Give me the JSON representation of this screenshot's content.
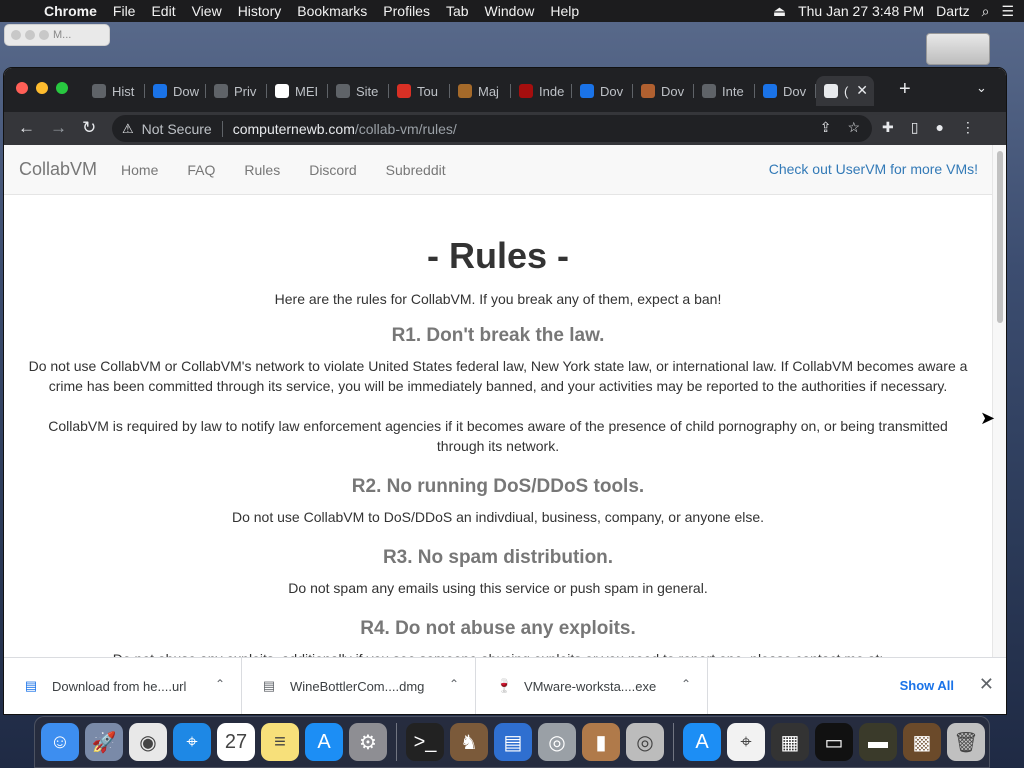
{
  "menubar": {
    "app": "Chrome",
    "items": [
      "File",
      "Edit",
      "View",
      "History",
      "Bookmarks",
      "Profiles",
      "Tab",
      "Window",
      "Help"
    ],
    "clock": "Thu Jan 27  3:48 PM",
    "user": "Dartz"
  },
  "minimized_window": {
    "label": "M..."
  },
  "browser": {
    "tabs": [
      {
        "label": "Hist",
        "icon": "history-icon",
        "color": "#5f6368"
      },
      {
        "label": "Dow",
        "icon": "chart-icon",
        "color": "#1a73e8"
      },
      {
        "label": "Priv",
        "icon": "flask-icon",
        "color": "#5f6368"
      },
      {
        "label": "MEI",
        "icon": "google-icon",
        "color": "#ffffff"
      },
      {
        "label": "Site",
        "icon": "globe-icon",
        "color": "#5f6368"
      },
      {
        "label": "Tou",
        "icon": "store-icon",
        "color": "#d93025"
      },
      {
        "label": "Maj",
        "icon": "lion-icon",
        "color": "#a56a2a"
      },
      {
        "label": "Inde",
        "icon": "wine-icon",
        "color": "#a50e0e"
      },
      {
        "label": "Dov",
        "icon": "vmware-icon",
        "color": "#1a73e8"
      },
      {
        "label": "Dov",
        "icon": "bottle-icon",
        "color": "#b06030"
      },
      {
        "label": "Inte",
        "icon": "archive-icon",
        "color": "#5f6368"
      },
      {
        "label": "Dov",
        "icon": "vmware-icon",
        "color": "#1a73e8"
      }
    ],
    "active_tab": {
      "label": "(",
      "icon": "collabvm-icon"
    },
    "address": {
      "security": "Not Secure",
      "host": "computernewb.com",
      "path": "/collab-vm/rules/"
    }
  },
  "site": {
    "brand": "CollabVM",
    "nav": [
      "Home",
      "FAQ",
      "Rules",
      "Discord",
      "Subreddit"
    ],
    "promo": "Check out UserVM for more VMs!",
    "title": "- Rules -",
    "intro": "Here are the rules for CollabVM. If you break any of them, expect a ban!",
    "rules": [
      {
        "heading": "R1. Don't break the law.",
        "paragraphs": [
          "Do not use CollabVM or CollabVM's network to violate United States federal law, New York state law, or international law. If CollabVM becomes aware a crime has been committed through its service, you will be immediately banned, and your activities may be reported to the authorities if necessary.",
          "CollabVM is required by law to notify law enforcement agencies if it becomes aware of the presence of child pornography on, or being transmitted through its network."
        ]
      },
      {
        "heading": "R2. No running DoS/DDoS tools.",
        "paragraphs": [
          "Do not use CollabVM to DoS/DDoS an indivdiual, business, company, or anyone else."
        ]
      },
      {
        "heading": "R3. No spam distribution.",
        "paragraphs": [
          "Do not spam any emails using this service or push spam in general."
        ]
      },
      {
        "heading": "R4. Do not abuse any exploits.",
        "paragraphs": [
          "Do not abuse any exploits, additionally if you see someone abusing exploits or you need to report one, please contact me at:"
        ]
      }
    ]
  },
  "downloads": {
    "items": [
      {
        "name": "Download from he....url",
        "icon": "url-file-icon"
      },
      {
        "name": "WineBottlerCom....dmg",
        "icon": "dmg-file-icon"
      },
      {
        "name": "VMware-worksta....exe",
        "icon": "wine-file-icon"
      }
    ],
    "show_all": "Show All"
  },
  "dock": {
    "apps": [
      {
        "name": "finder-icon",
        "bg": "#3d8ef0",
        "glyph": "☺"
      },
      {
        "name": "launchpad-icon",
        "bg": "#7a8aa8",
        "glyph": "🚀"
      },
      {
        "name": "chrome-icon",
        "bg": "#e8e8e8",
        "glyph": "◉"
      },
      {
        "name": "safari-icon",
        "bg": "#1e88e5",
        "glyph": "⌖"
      },
      {
        "name": "calendar-icon",
        "bg": "#ffffff",
        "glyph": "27"
      },
      {
        "name": "notes-icon",
        "bg": "#f7e07a",
        "glyph": "≡"
      },
      {
        "name": "app-store-icon",
        "bg": "#1c8ef5",
        "glyph": "A"
      },
      {
        "name": "system-preferences-icon",
        "bg": "#8e8e93",
        "glyph": "⚙"
      }
    ],
    "apps2": [
      {
        "name": "terminal-icon",
        "bg": "#222222",
        "glyph": ">_"
      },
      {
        "name": "chess-icon",
        "bg": "#7b5a3a",
        "glyph": "♞"
      },
      {
        "name": "network-utility-icon",
        "bg": "#2f6fd0",
        "glyph": "▤"
      },
      {
        "name": "installer-icon",
        "bg": "#9aa0a6",
        "glyph": "◎"
      },
      {
        "name": "wine-bottler-icon",
        "bg": "#b07a4a",
        "glyph": "▮"
      },
      {
        "name": "disk-icon",
        "bg": "#bcbcbc",
        "glyph": "◎"
      }
    ],
    "apps3": [
      {
        "name": "app-store-download-icon",
        "bg": "#1c8ef5",
        "glyph": "A"
      },
      {
        "name": "document-icon",
        "bg": "#f2f2f2",
        "glyph": "⌖"
      },
      {
        "name": "window-thumb-icon",
        "bg": "#333333",
        "glyph": "▦"
      },
      {
        "name": "window-thumb-icon",
        "bg": "#111111",
        "glyph": "▭"
      },
      {
        "name": "window-thumb-icon",
        "bg": "#3a3a2a",
        "glyph": "▬"
      },
      {
        "name": "chess-board-thumb-icon",
        "bg": "#6b4a2a",
        "glyph": "▩"
      },
      {
        "name": "trash-icon",
        "bg": "#c0c0c0",
        "glyph": "🗑"
      }
    ]
  }
}
